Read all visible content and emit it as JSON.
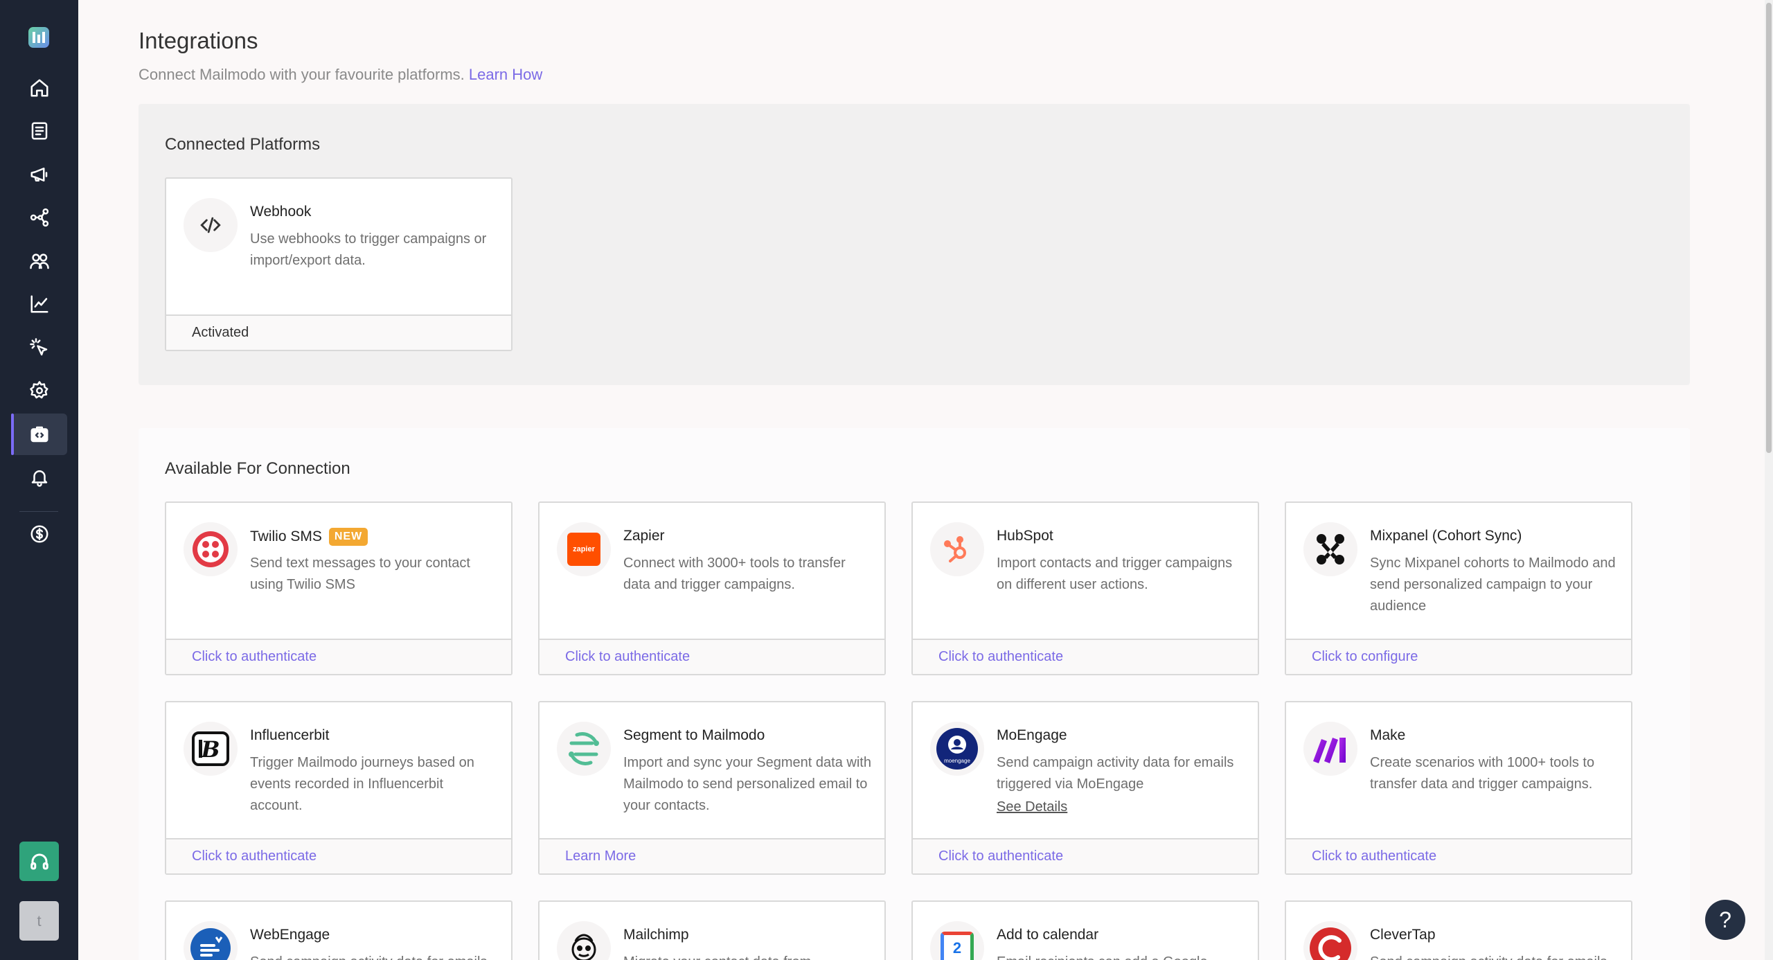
{
  "page": {
    "title": "Integrations",
    "subtitle": "Connect Mailmodo with your favourite platforms.",
    "learn_how": "Learn How"
  },
  "sidebar": {
    "items": [
      {
        "icon": "home-icon",
        "name": "nav-home"
      },
      {
        "icon": "document-icon",
        "name": "nav-templates"
      },
      {
        "icon": "megaphone-icon",
        "name": "nav-campaigns"
      },
      {
        "icon": "journey-icon",
        "name": "nav-journeys"
      },
      {
        "icon": "contacts-icon",
        "name": "nav-contacts"
      },
      {
        "icon": "analytics-icon",
        "name": "nav-analytics"
      },
      {
        "icon": "click-icon",
        "name": "nav-events"
      },
      {
        "icon": "gear-icon",
        "name": "nav-settings"
      },
      {
        "icon": "integrations-icon",
        "name": "nav-integrations",
        "active": true
      },
      {
        "icon": "bell-icon",
        "name": "nav-notifications"
      },
      {
        "icon": "billing-icon",
        "name": "nav-billing"
      }
    ],
    "avatar_initial": "t"
  },
  "connected": {
    "title": "Connected Platforms",
    "cards": [
      {
        "name": "Webhook",
        "desc": "Use webhooks to trigger campaigns or import/export data.",
        "status": "Activated",
        "icon": "code-icon"
      }
    ]
  },
  "available": {
    "title": "Available For Connection",
    "cards": [
      {
        "name": "Twilio SMS",
        "badge": "NEW",
        "desc": "Send text messages to your contact using Twilio SMS",
        "action": "Click to authenticate",
        "icon": "twilio-icon"
      },
      {
        "name": "Zapier",
        "desc": "Connect with 3000+ tools to transfer data and trigger campaigns.",
        "action": "Click to authenticate",
        "icon": "zapier-icon",
        "icon_text": "zapier"
      },
      {
        "name": "HubSpot",
        "desc": "Import contacts and trigger campaigns on different user actions.",
        "action": "Click to authenticate",
        "icon": "hubspot-icon"
      },
      {
        "name": "Mixpanel (Cohort Sync)",
        "desc": "Sync Mixpanel cohorts to Mailmodo and send personalized campaign to your audience",
        "action": "Click to configure",
        "icon": "mixpanel-icon"
      },
      {
        "name": "Influencerbit",
        "desc": "Trigger Mailmodo journeys based on events recorded in Influencerbit account.",
        "action": "Click to authenticate",
        "icon": "influencerbit-icon"
      },
      {
        "name": "Segment to Mailmodo",
        "desc": "Import and sync your Segment data with Mailmodo to send personalized email to your contacts.",
        "action": "Learn More",
        "icon": "segment-icon"
      },
      {
        "name": "MoEngage",
        "desc": "Send campaign activity data for emails triggered via MoEngage",
        "details": "See Details",
        "action": "Click to authenticate",
        "icon": "moengage-icon",
        "icon_text": "moengage"
      },
      {
        "name": "Make",
        "desc": "Create scenarios with 1000+ tools to transfer data and trigger campaigns.",
        "action": "Click to authenticate",
        "icon": "make-icon"
      },
      {
        "name": "WebEngage",
        "desc": "Send campaign activity data for emails",
        "icon": "webengage-icon"
      },
      {
        "name": "Mailchimp",
        "desc": "Migrate your contact data from",
        "icon": "mailchimp-icon"
      },
      {
        "name": "Add to calendar",
        "desc": "Email recipients can add a Google",
        "icon": "calendar-icon",
        "icon_text": "2"
      },
      {
        "name": "CleverTap",
        "desc": "Send campaign activity data for emails",
        "icon": "clevertap-icon"
      }
    ]
  },
  "help": {
    "label": "?"
  },
  "colors": {
    "sidebar": "#1d2433",
    "accent": "#7b6ae6",
    "badge": "#f3a832"
  }
}
